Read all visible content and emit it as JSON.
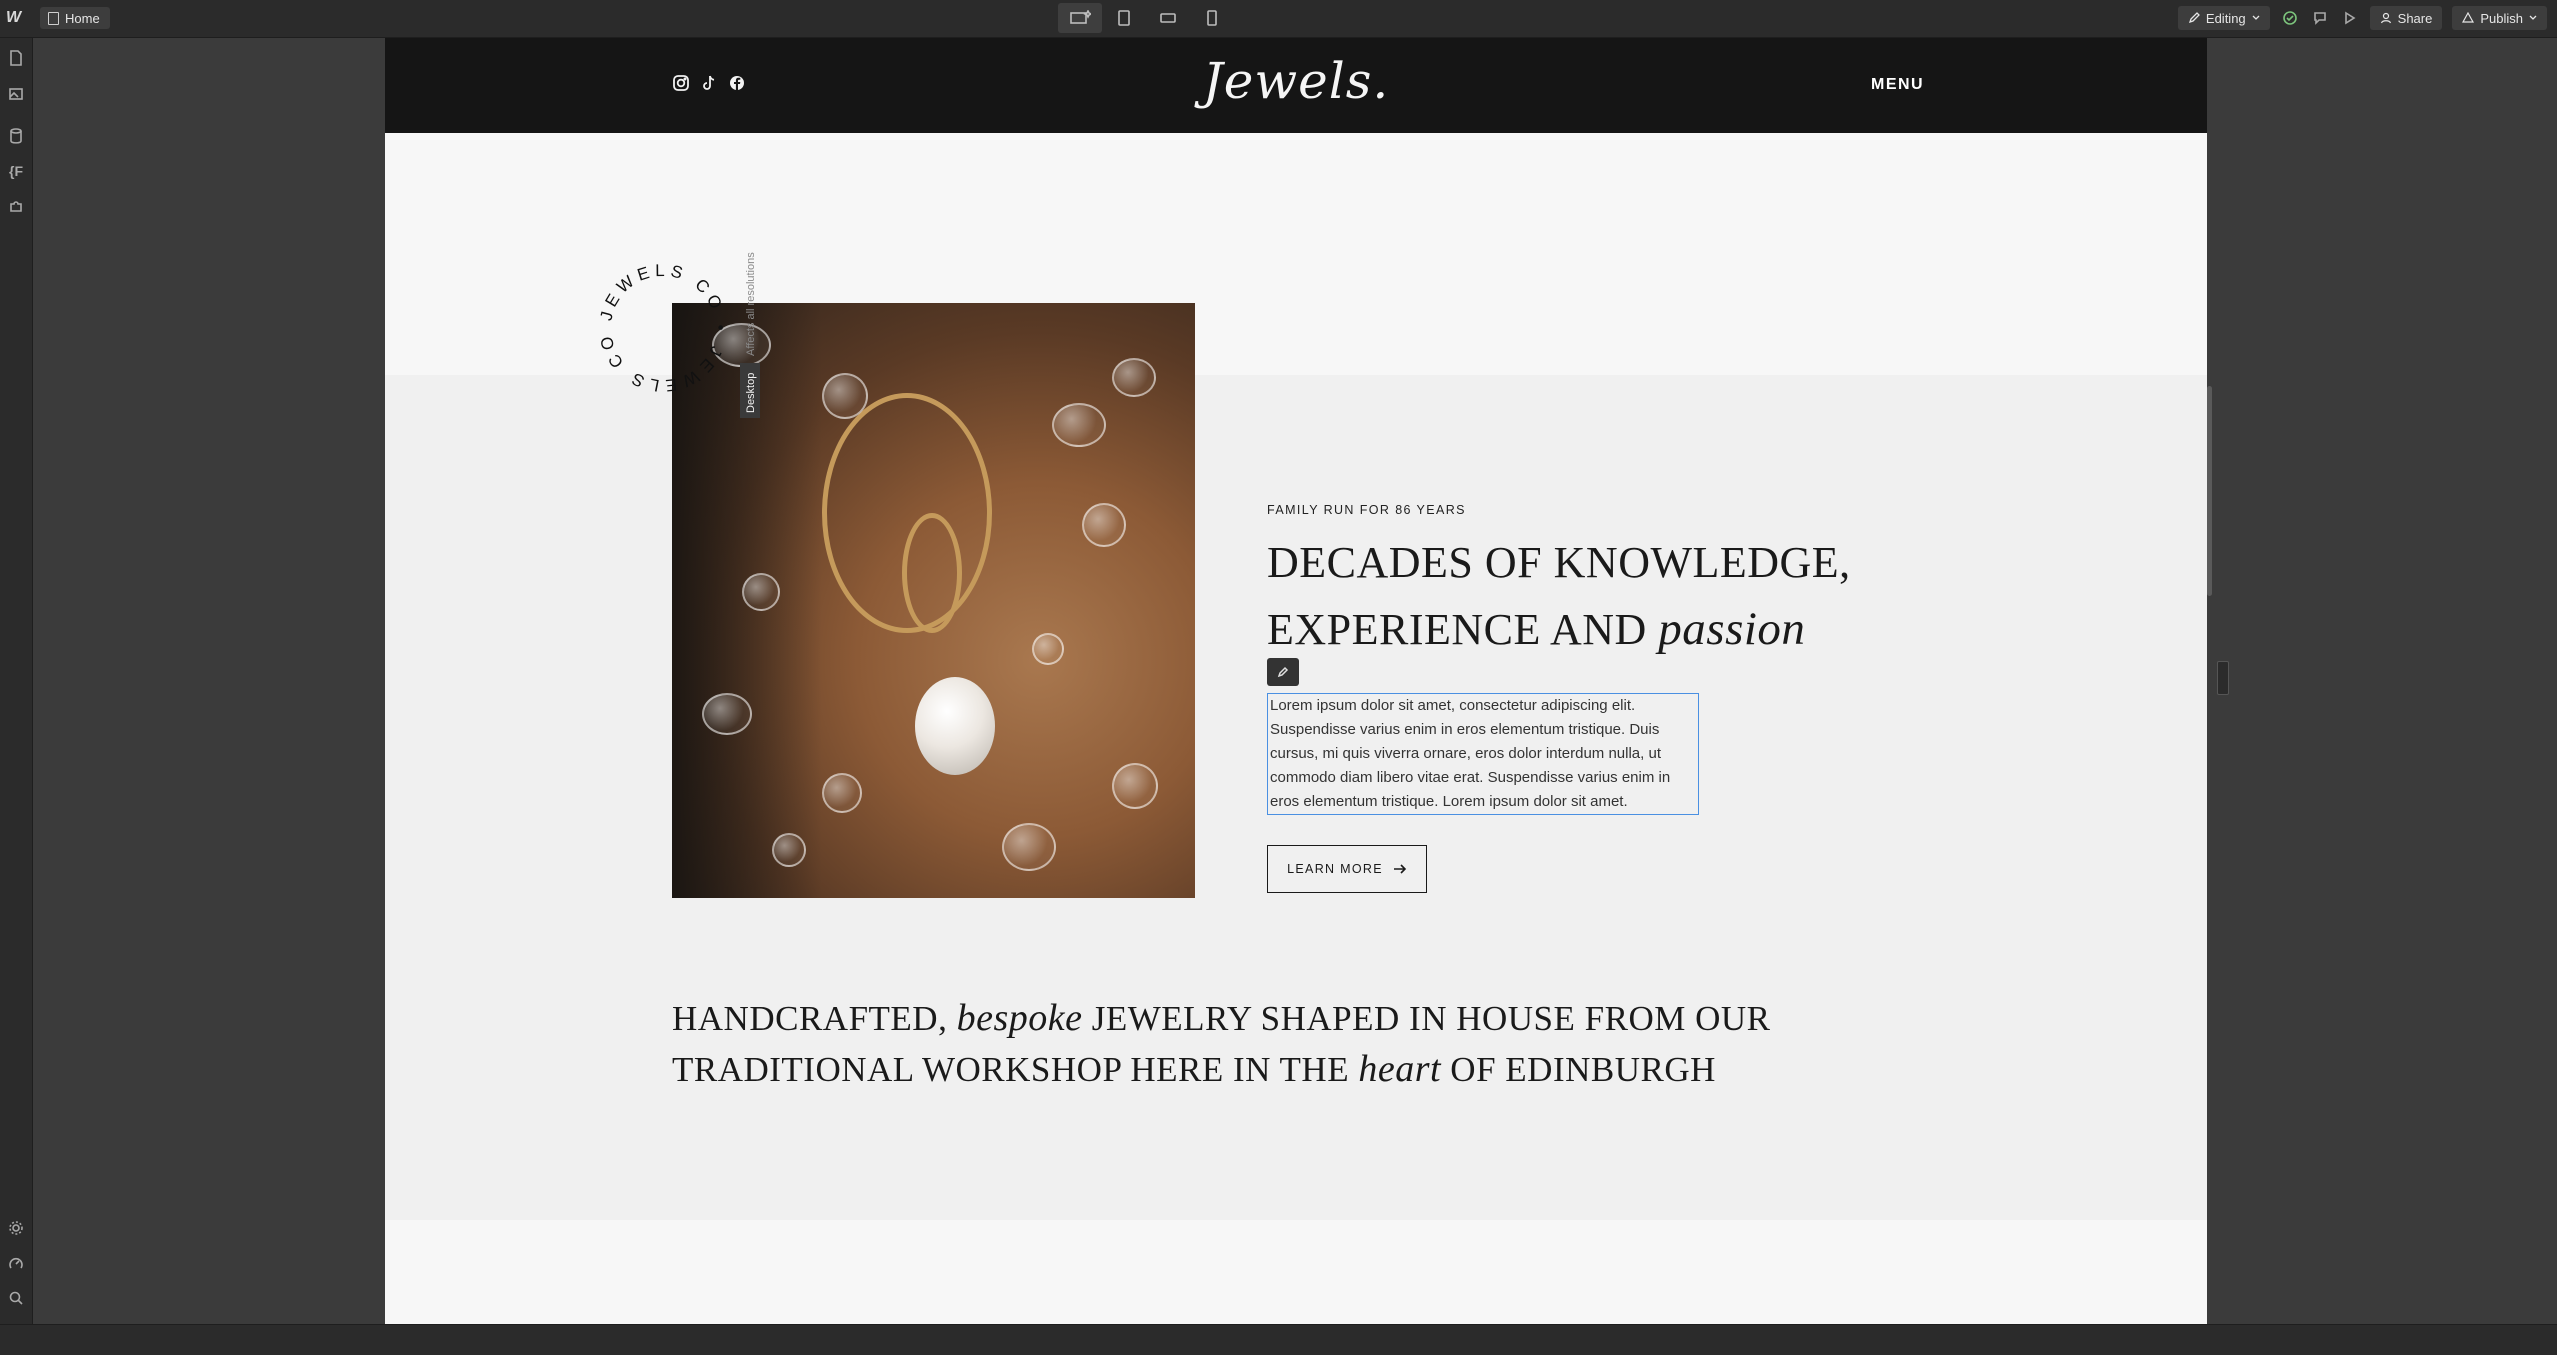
{
  "topbar": {
    "home_label": "Home",
    "editing_label": "Editing",
    "share_label": "Share",
    "publish_label": "Publish"
  },
  "breakpoint": {
    "desktop_label": "Desktop",
    "affects_label": "Affects all resolutions"
  },
  "site": {
    "brand": "Jewels.",
    "menu_label": "MENU",
    "circle_text": "JEWELS CO • JEWELS CO • ",
    "eyebrow": "FAMILY RUN FOR 86 YEARS",
    "heading_line1": "DECADES OF KNOWLEDGE,",
    "heading_line2_plain": "EXPERIENCE AND ",
    "heading_line2_italic": "passion",
    "paragraph": "Lorem ipsum dolor sit amet, consectetur adipiscing elit. Suspendisse varius enim in eros elementum tristique. Duis cursus, mi quis viverra ornare, eros dolor interdum nulla, ut commodo diam libero vitae erat. Suspendisse varius enim in eros elementum tristique. Lorem ipsum dolor sit amet.",
    "learn_more": "LEARN MORE",
    "tagline_1": "HANDCRAFTED, ",
    "tagline_2": "bespoke",
    "tagline_3": " JEWELRY SHAPED IN HOUSE FROM OUR",
    "tagline_4": "TRADITIONAL WORKSHOP HERE IN THE ",
    "tagline_5": "heart",
    "tagline_6": " OF EDINBURGH"
  },
  "colors": {
    "nav_bg": "#151515",
    "selection_border": "#4a90e2",
    "editor_chrome": "#2b2b2b"
  }
}
